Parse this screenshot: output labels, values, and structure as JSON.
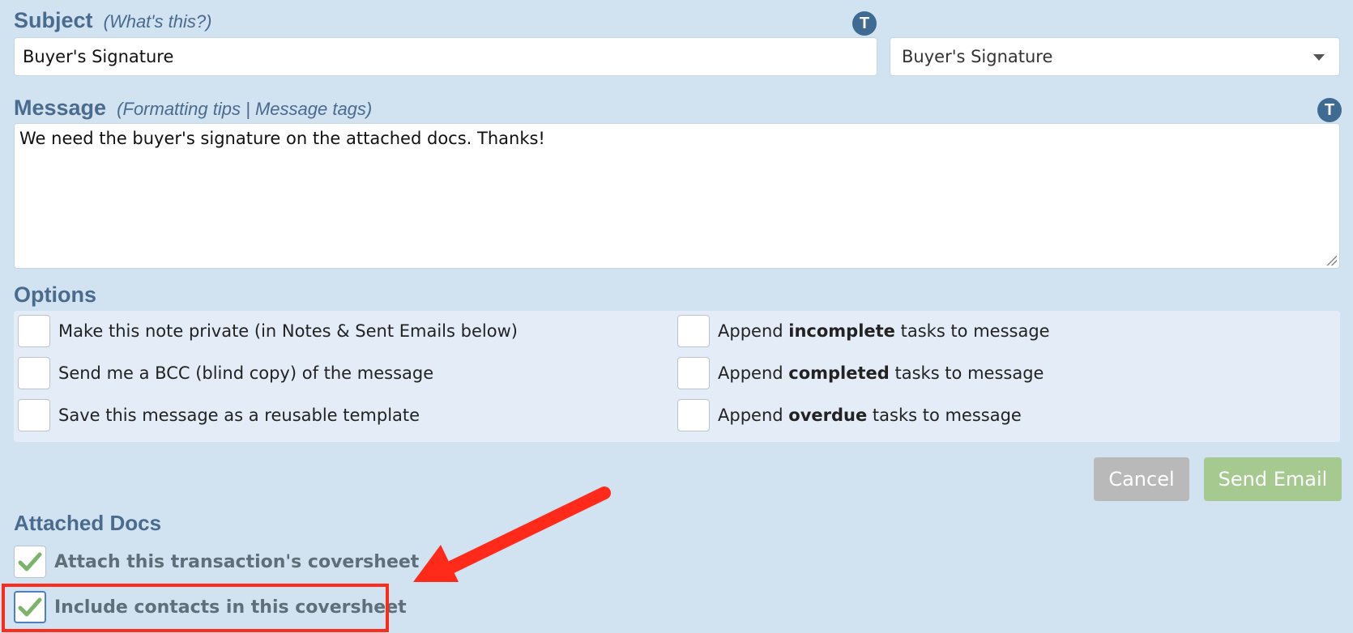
{
  "subject": {
    "label": "Subject",
    "hint": "(What's this?)",
    "value": "Buyer's Signature"
  },
  "template_select": {
    "selected": "Buyer's Signature"
  },
  "message": {
    "label": "Message",
    "hint_open": "(",
    "hint_formatting": "Formatting tips",
    "hint_sep": " | ",
    "hint_tags": "Message tags",
    "hint_close": ")",
    "value": "We need the buyer's signature on the attached docs. Thanks!"
  },
  "icons": {
    "template_icon_glyph": "T"
  },
  "options": {
    "label": "Options",
    "left": [
      {
        "label": "Make this note private (in Notes & Sent Emails below)",
        "checked": false
      },
      {
        "label": "Send me a BCC (blind copy) of the message",
        "checked": false
      },
      {
        "label": "Save this message as a reusable template",
        "checked": false
      }
    ],
    "right": [
      {
        "prefix": "Append ",
        "bold": "incomplete",
        "suffix": " tasks to message",
        "checked": false
      },
      {
        "prefix": "Append ",
        "bold": "completed",
        "suffix": " tasks to message",
        "checked": false
      },
      {
        "prefix": "Append ",
        "bold": "overdue",
        "suffix": " tasks to message",
        "checked": false
      }
    ]
  },
  "buttons": {
    "cancel": "Cancel",
    "send": "Send Email"
  },
  "attached_docs": {
    "label": "Attached Docs",
    "items": [
      {
        "label": "Attach this transaction's coversheet",
        "checked": true
      },
      {
        "label": "Include contacts in this coversheet",
        "checked": true
      }
    ]
  },
  "colors": {
    "background": "#d1e2f1",
    "label_blue": "#4a6b8e",
    "annotation_red": "#ff2a1a",
    "check_green": "#7cb36a"
  }
}
